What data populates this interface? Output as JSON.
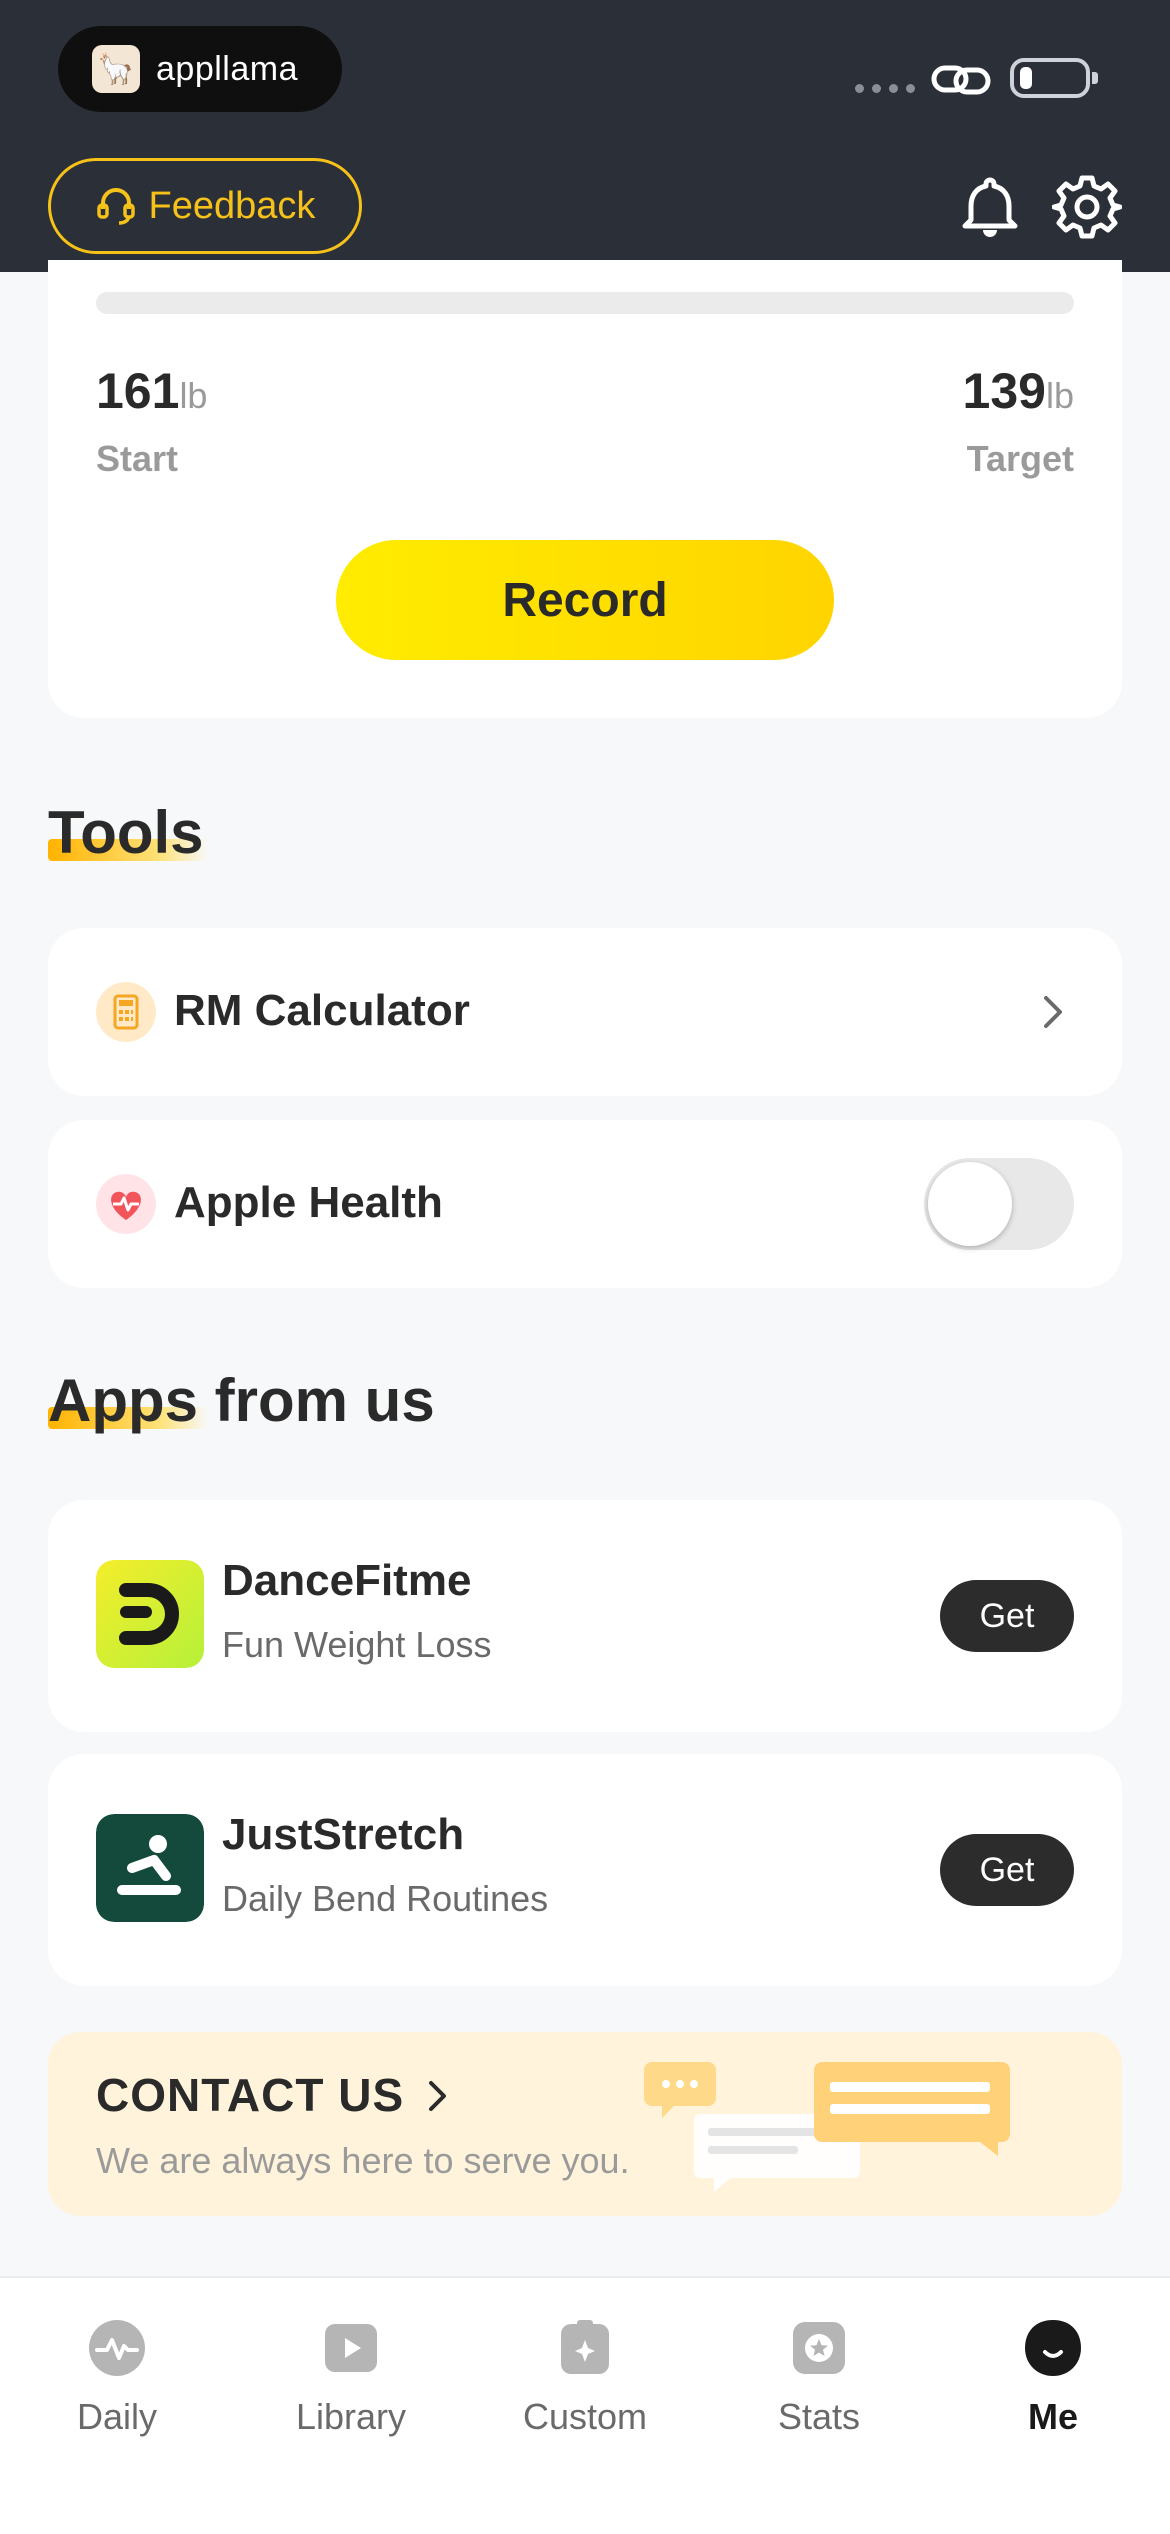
{
  "header": {
    "brand_name": "appllama",
    "feedback_label": "Feedback"
  },
  "weight": {
    "start_value": "161",
    "target_value": "139",
    "unit": "lb",
    "start_label": "Start",
    "target_label": "Target",
    "record_label": "Record"
  },
  "tools": {
    "title": "Tools",
    "items": [
      {
        "label": "RM Calculator",
        "icon": "calculator-icon"
      },
      {
        "label": "Apple Health",
        "icon": "heart-health-icon",
        "toggle_on": false
      }
    ]
  },
  "apps": {
    "title": "Apps from us",
    "items": [
      {
        "name": "DanceFitme",
        "desc": "Fun Weight Loss",
        "get_label": "Get"
      },
      {
        "name": "JustStretch",
        "desc": "Daily Bend Routines",
        "get_label": "Get"
      }
    ]
  },
  "contact": {
    "title": "CONTACT US",
    "subtitle": "We are always here to serve you."
  },
  "tabbar": {
    "tabs": [
      {
        "label": "Daily",
        "icon": "pulse-icon"
      },
      {
        "label": "Library",
        "icon": "play-icon"
      },
      {
        "label": "Custom",
        "icon": "clipboard-sparkle-icon"
      },
      {
        "label": "Stats",
        "icon": "star-badge-icon"
      },
      {
        "label": "Me",
        "icon": "profile-icon",
        "active": true
      }
    ]
  },
  "colors": {
    "accent_yellow": "#ffdd00",
    "header_bg": "#2b2f37",
    "feedback_yellow": "#f6c21a"
  }
}
